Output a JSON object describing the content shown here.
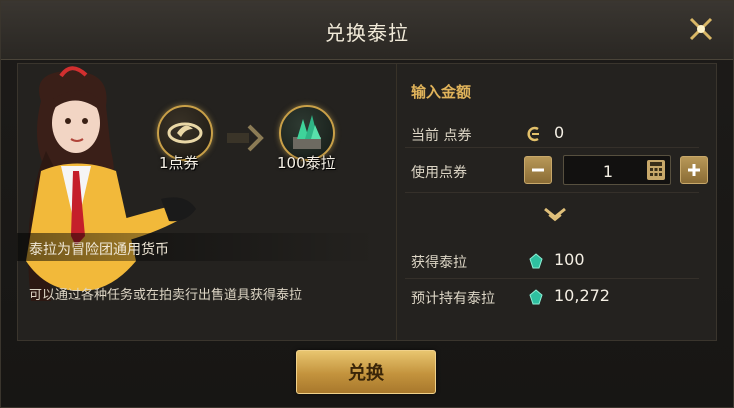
{
  "dialog": {
    "title": "兑换泰拉"
  },
  "conversion": {
    "from_label": "1点券",
    "to_label": "100泰拉"
  },
  "info": {
    "line1": "泰拉为冒险团通用货币",
    "line2": "可以通过各种任务或在拍卖行出售道具获得泰拉"
  },
  "form": {
    "section_title": "输入金额",
    "current_label": "当前 点券",
    "current_value": "0",
    "use_label": "使用点券",
    "use_value": "1",
    "obtain_label": "获得泰拉",
    "obtain_value": "100",
    "expected_label": "预计持有泰拉",
    "expected_value": "10,272"
  },
  "buttons": {
    "confirm_label": "兑换"
  },
  "colors": {
    "accent_gold": "#e0b35a",
    "button_gold": "#c3933d",
    "gem_green": "#2fc0a0"
  }
}
